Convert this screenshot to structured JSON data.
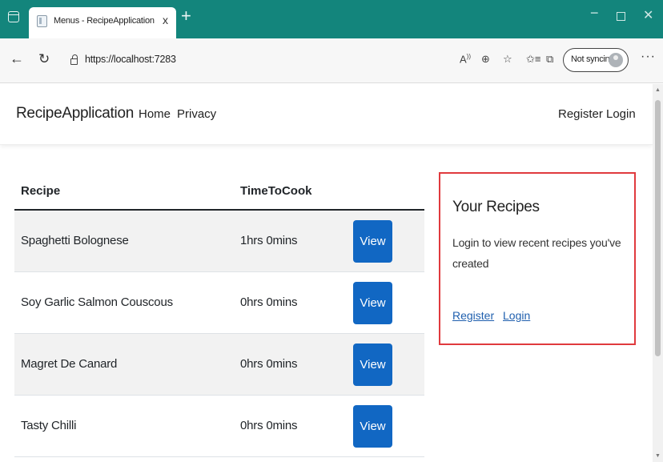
{
  "browser": {
    "tab_title": "Menus - RecipeApplication",
    "tab_close": "x",
    "new_tab": "+",
    "url": "https://localhost:7283",
    "sync_label": "Not syncing",
    "more": "···",
    "icons": [
      "window-icon",
      "favicon-icon",
      "back-icon",
      "reload-icon",
      "lock-icon",
      "read-aloud-icon",
      "zoom-icon",
      "favorite-icon",
      "favorites-icon",
      "collections-icon",
      "profile-icon"
    ]
  },
  "site": {
    "brand": "RecipeApplication",
    "nav_left": [
      "Home",
      "Privacy"
    ],
    "nav_right": [
      "Register",
      "Login"
    ]
  },
  "table": {
    "headers": [
      "Recipe",
      "TimeToCook"
    ],
    "rows": [
      {
        "recipe": "Spaghetti Bolognese",
        "time": "1hrs 0mins",
        "action": "View"
      },
      {
        "recipe": "Soy Garlic Salmon Couscous",
        "time": "0hrs 0mins",
        "action": "View"
      },
      {
        "recipe": "Magret De Canard",
        "time": "0hrs 0mins",
        "action": "View"
      },
      {
        "recipe": "Tasty Chilli",
        "time": "0hrs 0mins",
        "action": "View"
      }
    ]
  },
  "card": {
    "title": "Your Recipes",
    "text": "Login to view recent recipes you've created",
    "links": [
      "Register",
      "Login"
    ],
    "border_color": "#e03a3e"
  },
  "colors": {
    "titlebar": "#13857c",
    "button": "#1167c3"
  }
}
